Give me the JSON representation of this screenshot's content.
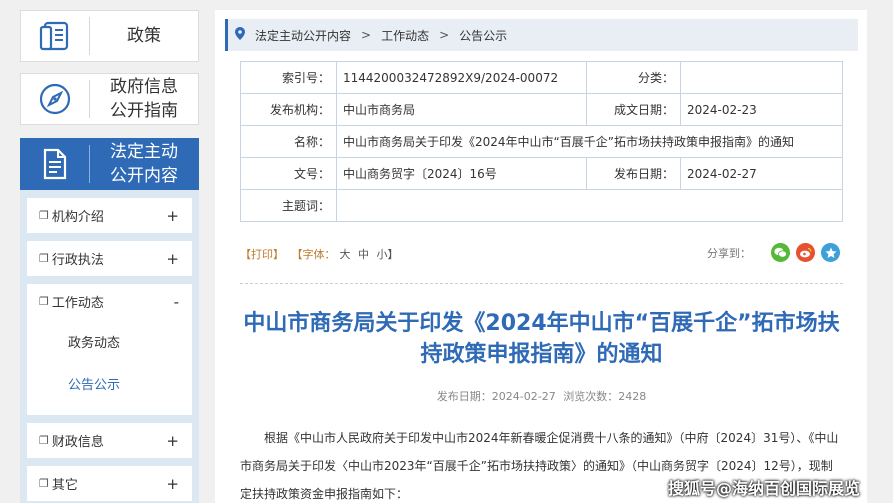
{
  "nav": {
    "tiles": [
      {
        "label": "政策",
        "icon": "document-icon"
      },
      {
        "label": "政府信息公开指南",
        "label_lines": [
          "政府信息",
          "公开指南"
        ],
        "icon": "compass-icon"
      },
      {
        "label": "法定主动公开内容",
        "label_lines": [
          "法定主动",
          "公开内容"
        ],
        "icon": "file-icon"
      }
    ],
    "menu": [
      {
        "label": "机构介绍",
        "sign": "+"
      },
      {
        "label": "行政执法",
        "sign": "+"
      },
      {
        "label": "工作动态",
        "sign": "-"
      },
      {
        "label": "财政信息",
        "sign": "+"
      },
      {
        "label": "其它",
        "sign": "+"
      }
    ],
    "submenu": [
      "政务动态",
      "公告公示"
    ]
  },
  "breadcrumb": [
    "法定主动公开内容",
    "工作动态",
    "公告公示"
  ],
  "meta": {
    "index_label": "索引号：",
    "index_value": "1144200032472892X9/2024-00072",
    "category_label": "分类：",
    "category_value": "",
    "publisher_label": "发布机构：",
    "publisher_value": "中山市商务局",
    "created_label": "成文日期：",
    "created_value": "2024-02-23",
    "name_label": "名称：",
    "name_value": "中山市商务局关于印发《2024年中山市“百展千企”拓市场扶持政策申报指南》的通知",
    "docno_label": "文号：",
    "docno_value": "中山商务贸字〔2024〕16号",
    "pubdate_label": "发布日期：",
    "pubdate_value": "2024-02-27",
    "subject_label": "主题词：",
    "subject_value": ""
  },
  "tools": {
    "print": "【打印】",
    "font": "【字体：",
    "large": "大",
    "medium": "中",
    "small": "小】",
    "share_label": "分享到："
  },
  "article": {
    "title": "中山市商务局关于印发《2024年中山市“百展千企”拓市场扶持政策申报指南》的通知",
    "pub_label": "发布日期：2024-02-27",
    "views_label": "浏览次数：2428",
    "paragraph": "根据《中山市人民政府关于印发中山市2024年新春暖企促消费十八条的通知》（中府〔2024〕31号）、《中山市商务局关于印发〈中山市2023年“百展千企”拓市场扶持政策〉的通知》（中山商务贸字〔2024〕12号），现制定扶持政策资金申报指南如下："
  },
  "watermark": "搜狐号@海纳百创国际展览",
  "colors": {
    "accent": "#2f6ab6",
    "crumb_bg": "#e9eef4",
    "menu_bg": "#dbe7f1"
  }
}
